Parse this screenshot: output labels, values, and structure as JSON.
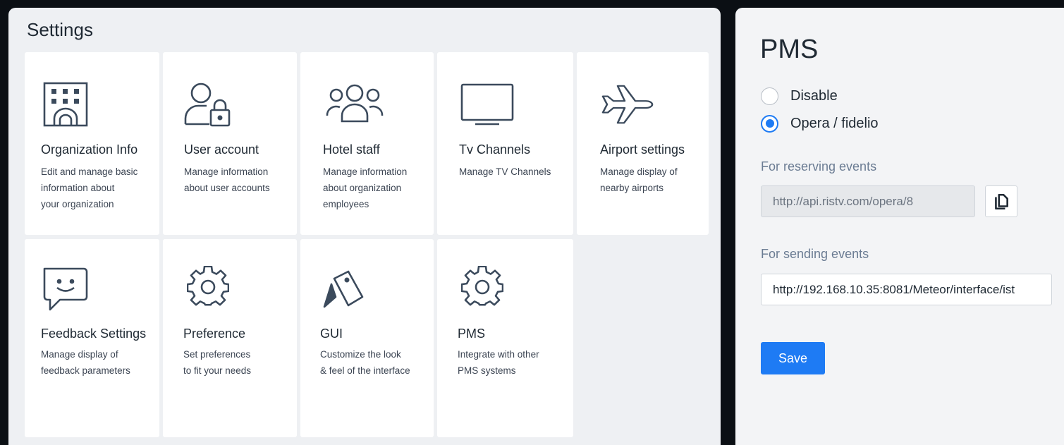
{
  "settings": {
    "title": "Settings",
    "cards": [
      {
        "title": "Organization Info",
        "desc": "Edit and manage basic\ninformation about\nyour organization",
        "icon": "building-icon"
      },
      {
        "title": "User account",
        "desc": "Manage information\nabout user accounts",
        "icon": "user-lock-icon"
      },
      {
        "title": "Hotel staff",
        "desc": "Manage information\nabout organization\nemployees",
        "icon": "users-group-icon"
      },
      {
        "title": "Tv Channels",
        "desc": "Manage TV Channels",
        "icon": "tv-icon"
      },
      {
        "title": "Airport settings",
        "desc": "Manage display of\nnearby airports",
        "icon": "airplane-icon"
      },
      {
        "title": "Feedback Settings",
        "desc": "Manage display of\nfeedback parameters",
        "icon": "feedback-icon"
      },
      {
        "title": "Preference",
        "desc": "Set preferences\nto fit your needs",
        "icon": "gear-icon"
      },
      {
        "title": "GUI",
        "desc": "Customize the look\n& feel of the interface",
        "icon": "palette-card-icon"
      },
      {
        "title": "PMS",
        "desc": "Integrate with other\nPMS systems",
        "icon": "gear-icon"
      }
    ]
  },
  "pms": {
    "title": "PMS",
    "options": [
      {
        "label": "Disable",
        "checked": false
      },
      {
        "label": "Opera / fidelio",
        "checked": true
      }
    ],
    "reserving_label": "For reserving events",
    "reserving_value": "http://api.ristv.com/opera/8",
    "sending_label": "For sending events",
    "sending_value": "http://192.168.10.35:8081/Meteor/interface/ist",
    "save_label": "Save",
    "accent_color": "#1e7bf4"
  }
}
